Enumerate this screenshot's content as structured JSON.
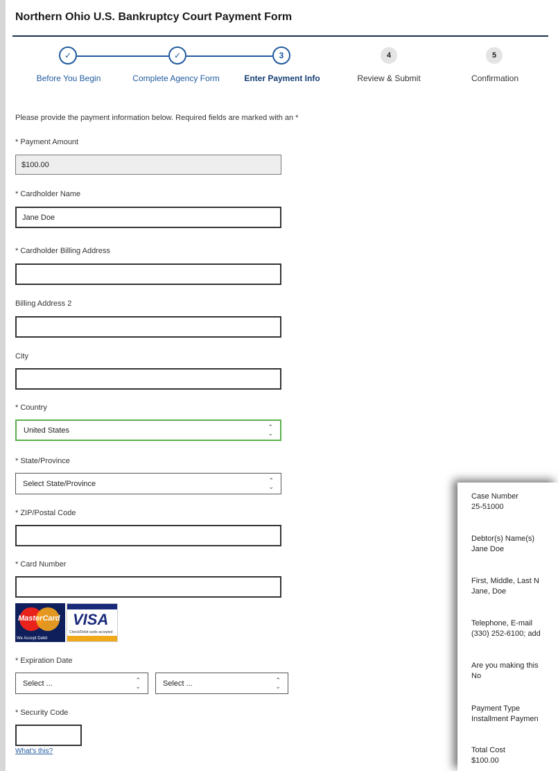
{
  "header": {
    "title": "Northern Ohio U.S. Bankruptcy Court Payment Form"
  },
  "stepper": {
    "steps": [
      {
        "marker": "✓",
        "label": "Before You Begin"
      },
      {
        "marker": "✓",
        "label": "Complete Agency Form"
      },
      {
        "marker": "3",
        "label": "Enter Payment Info"
      },
      {
        "marker": "4",
        "label": "Review & Submit"
      },
      {
        "marker": "5",
        "label": "Confirmation"
      }
    ],
    "current_step": 3
  },
  "form": {
    "intro": "Please provide the payment information below. Required fields are marked with an *",
    "payment_amount": {
      "label": "* Payment Amount",
      "value": "$100.00"
    },
    "cardholder_name": {
      "label": "* Cardholder Name",
      "value": "Jane Doe"
    },
    "billing_address": {
      "label": "* Cardholder Billing Address",
      "value": ""
    },
    "billing_address_2": {
      "label": "Billing Address 2",
      "value": ""
    },
    "city": {
      "label": "City",
      "value": ""
    },
    "country": {
      "label": "* Country",
      "value": "United States"
    },
    "state": {
      "label": "* State/Province",
      "value": "Select State/Province"
    },
    "zip": {
      "label": "* ZIP/Postal Code",
      "value": ""
    },
    "card_number": {
      "label": "* Card Number",
      "value": ""
    },
    "accepted_cards": {
      "mastercard": {
        "text": "MasterCard",
        "sub": "We Accept Debit"
      },
      "visa": {
        "text": "VISA",
        "sub": "Check/Debit cards accepted"
      }
    },
    "expiration": {
      "label": "* Expiration Date",
      "month": "Select ...",
      "year": "Select ..."
    },
    "security_code": {
      "label": "* Security Code",
      "value": "",
      "help_link": "What's this?"
    }
  },
  "summary": {
    "items": [
      {
        "label": "Case Number",
        "value": "25-51000"
      },
      {
        "label": "Debtor(s) Name(s)",
        "value": "Jane Doe"
      },
      {
        "label": "First, Middle, Last N",
        "value": "Jane, Doe"
      },
      {
        "label": "Telephone, E-mail",
        "value": "(330) 252-6100; add"
      },
      {
        "label": "Are you making this",
        "value": "No"
      },
      {
        "label": "Payment Type",
        "value": "Installment Paymen"
      },
      {
        "label": "Total Cost",
        "value": "$100.00"
      }
    ]
  },
  "colors": {
    "accent": "#1f5a9e",
    "header_rule": "#1c2f4a",
    "focus_border": "#59b04a",
    "background": "#d7d7d7"
  }
}
